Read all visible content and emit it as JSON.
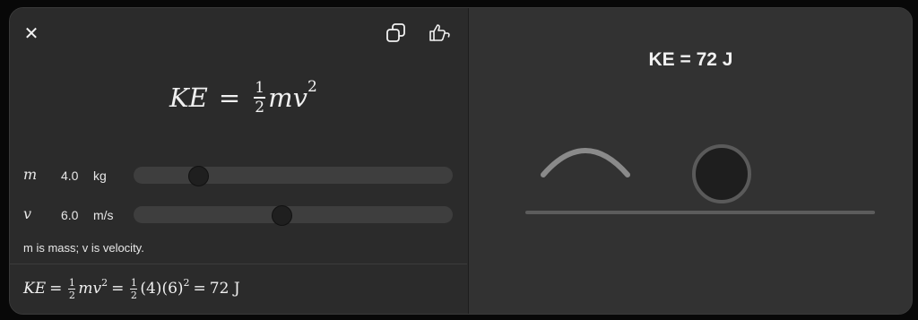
{
  "header": {
    "close_label": "✕",
    "copy_icon": "copy-icon",
    "feedback_icon": "thumbs-up-down-icon"
  },
  "formula": {
    "lhs": "KE",
    "eq": "=",
    "frac_num": "1",
    "frac_den": "2",
    "rhs": "mv",
    "exp": "2"
  },
  "controls": {
    "mass": {
      "symbol": "m",
      "value": "4.0",
      "unit": "kg",
      "slider_fraction": 0.2
    },
    "velocity": {
      "symbol": "v",
      "value": "6.0",
      "unit": "m/s",
      "slider_fraction": 0.46
    }
  },
  "description": "m is mass; v is velocity.",
  "computation": {
    "lhs": "KE",
    "eq": "=",
    "frac_num": "1",
    "frac_den": "2",
    "rhs": "mv",
    "exp": "2",
    "mid": "(4)(6)",
    "mid_exp": "2",
    "result": "72 J"
  },
  "result_panel": {
    "title": "KE = 72 J"
  },
  "colors": {
    "panel_left": "#2b2b2b",
    "panel_right": "#323232",
    "slider_track": "#3e3e3e",
    "slider_thumb": "#1f1f1f",
    "arc": "#8a8a8a",
    "ball_fill": "#1e1e1e",
    "ball_stroke": "#5a5a5a",
    "ground": "#5c5c5c"
  }
}
